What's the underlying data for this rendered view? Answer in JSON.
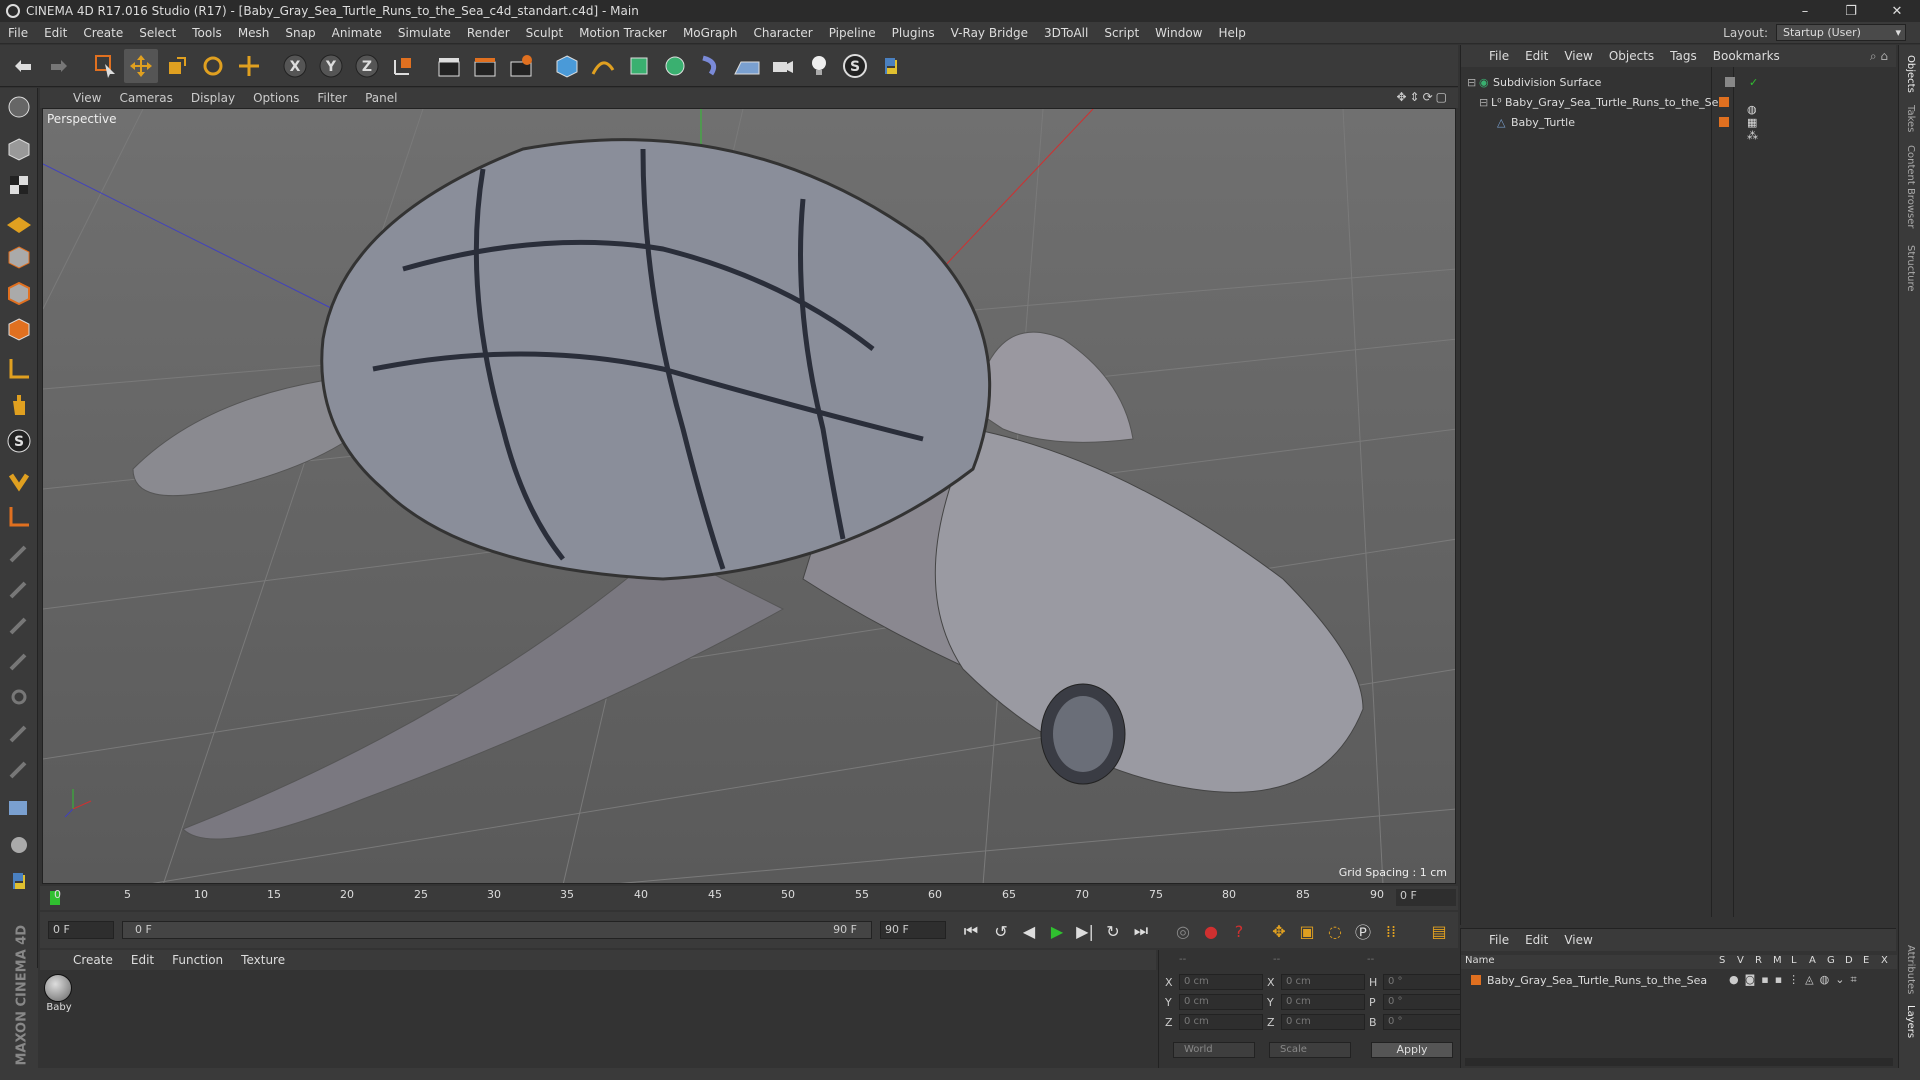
{
  "window": {
    "title": "CINEMA 4D R17.016 Studio (R17) - [Baby_Gray_Sea_Turtle_Runs_to_the_Sea_c4d_standart.c4d] - Main",
    "buttons": [
      "–",
      "❐",
      "✕"
    ]
  },
  "menubar": {
    "items": [
      "File",
      "Edit",
      "Create",
      "Select",
      "Tools",
      "Mesh",
      "Snap",
      "Animate",
      "Simulate",
      "Render",
      "Sculpt",
      "Motion Tracker",
      "MoGraph",
      "Character",
      "Pipeline",
      "Plugins",
      "V-Ray Bridge",
      "3DToAll",
      "Script",
      "Window",
      "Help"
    ],
    "layout_label": "Layout:",
    "layout_value": "Startup (User)"
  },
  "viewport": {
    "menu": [
      "View",
      "Cameras",
      "Display",
      "Options",
      "Filter",
      "Panel"
    ],
    "label": "Perspective",
    "grid_spacing": "Grid Spacing : 1 cm"
  },
  "timeline": {
    "ticks": [
      "0",
      "5",
      "10",
      "15",
      "20",
      "25",
      "30",
      "35",
      "40",
      "45",
      "50",
      "55",
      "60",
      "65",
      "70",
      "75",
      "80",
      "85",
      "90"
    ],
    "frame": "0 F"
  },
  "transport": {
    "start": "0 F",
    "range_start": "0 F",
    "range_end": "90 F",
    "end": "90 F"
  },
  "material": {
    "menu": [
      "Create",
      "Edit",
      "Function",
      "Texture"
    ],
    "name": "Baby"
  },
  "coords": {
    "header": [
      "--",
      "--",
      "--"
    ],
    "rows": [
      {
        "l1": "X",
        "v1": "0 cm",
        "l2": "X",
        "v2": "0 cm",
        "l3": "H",
        "v3": "0 °"
      },
      {
        "l1": "Y",
        "v1": "0 cm",
        "l2": "Y",
        "v2": "0 cm",
        "l3": "P",
        "v3": "0 °"
      },
      {
        "l1": "Z",
        "v1": "0 cm",
        "l2": "Z",
        "v2": "0 cm",
        "l3": "B",
        "v3": "0 °"
      }
    ],
    "world": "World",
    "scale": "Scale",
    "apply": "Apply"
  },
  "objects": {
    "menu": [
      "File",
      "Edit",
      "View",
      "Objects",
      "Tags",
      "Bookmarks"
    ],
    "items": [
      "Subdivision Surface",
      "Baby_Gray_Sea_Turtle_Runs_to_the_Sea",
      "Baby_Turtle"
    ]
  },
  "layers": {
    "menu": [
      "File",
      "Edit",
      "View"
    ],
    "columns": [
      "Name",
      "S",
      "V",
      "R",
      "M",
      "L",
      "A",
      "G",
      "D",
      "E",
      "X"
    ],
    "item": "Baby_Gray_Sea_Turtle_Runs_to_the_Sea"
  },
  "side_tabs": [
    "Objects",
    "Takes",
    "Content Browser",
    "Structure",
    "Attributes",
    "Layers"
  ],
  "branding": "MAXON CINEMA 4D",
  "colors": {
    "accent": "#e07020",
    "bg": "#333333",
    "panel": "#3a3a3a"
  }
}
